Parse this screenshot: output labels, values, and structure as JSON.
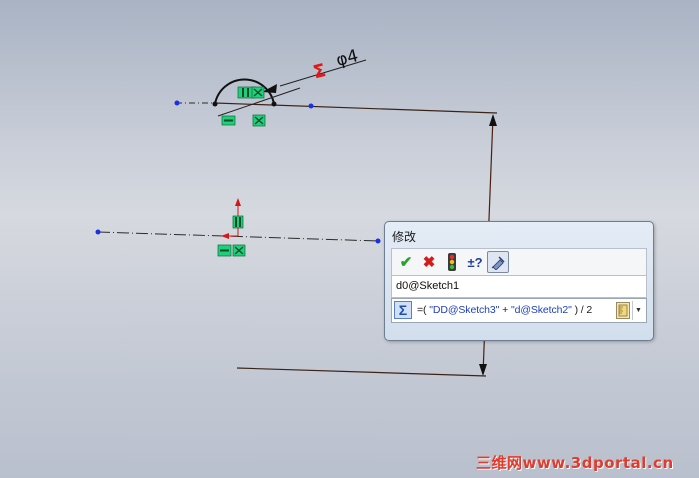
{
  "dimension": {
    "sigma_symbol": "Σ",
    "value_text": "φ4"
  },
  "dialog": {
    "title": "修改",
    "toolbar": {
      "ok_icon": "✔",
      "cancel_icon": "✖",
      "rebuild_icon": "traffic-light-icon",
      "reverse_label": "±?",
      "mark_icon": "pin-icon"
    },
    "dimension_name": "d0@Sketch1",
    "equation": {
      "sigma_label": "Σ",
      "prefix": "=( ",
      "term1": "\"DD@Sketch3\"",
      "operator": " + ",
      "term2": "\"d@Sketch2\"",
      "suffix": " ) / 2"
    }
  },
  "watermark": "三维网www.3dportal.cn",
  "colors": {
    "relation_green": "#1fd07a",
    "sketch_line": "#1a1a1a",
    "dimension_line": "#4a1f10",
    "point_blue": "#1b2fe6",
    "sigma_red": "#e01818"
  }
}
